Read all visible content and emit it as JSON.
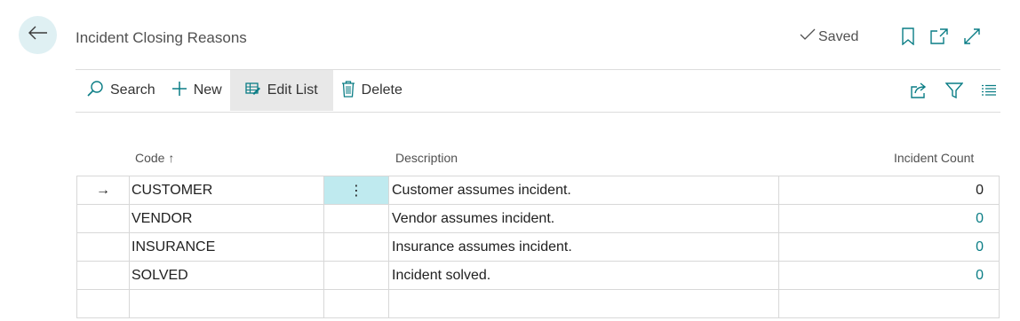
{
  "header": {
    "title": "Incident Closing Reasons",
    "saved_label": "Saved",
    "icons": [
      "back-arrow-icon",
      "bookmark-icon",
      "open-new-window-icon",
      "expand-icon"
    ]
  },
  "toolbar": {
    "search_label": "Search",
    "new_label": "New",
    "edit_list_label": "Edit List",
    "delete_label": "Delete",
    "right_icons": [
      "share-icon",
      "filter-icon",
      "list-view-icon"
    ]
  },
  "table": {
    "columns": {
      "code": "Code",
      "code_sort": "↑",
      "description": "Description",
      "incident_count": "Incident Count"
    },
    "rows": [
      {
        "marker": "→",
        "code": "CUSTOMER",
        "more": "⋮",
        "description": "Customer assumes incident.",
        "count": "0"
      },
      {
        "marker": "",
        "code": "VENDOR",
        "more": "",
        "description": "Vendor assumes incident.",
        "count": "0"
      },
      {
        "marker": "",
        "code": "INSURANCE",
        "more": "",
        "description": "Insurance assumes incident.",
        "count": "0"
      },
      {
        "marker": "",
        "code": "SOLVED",
        "more": "",
        "description": "Incident solved.",
        "count": "0"
      },
      {
        "marker": "",
        "code": "",
        "more": "",
        "description": "",
        "count": ""
      }
    ]
  },
  "colors": {
    "accent": "#0a7d85",
    "back_button_bg": "#dff0f3",
    "selected_cell_bg": "#bfeaef",
    "active_button_bg": "#e8e8e8"
  }
}
